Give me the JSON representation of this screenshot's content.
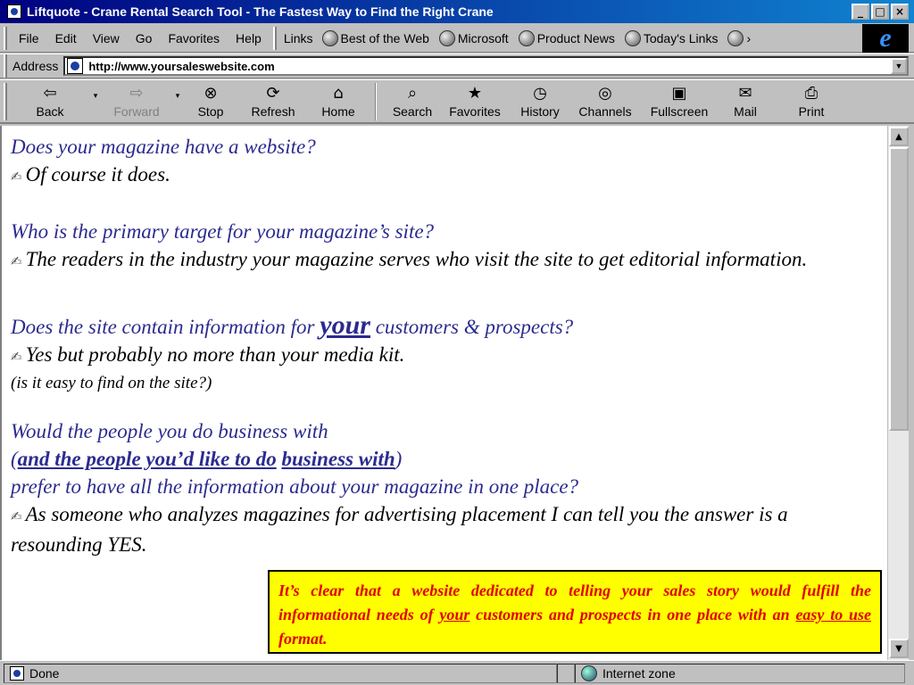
{
  "window": {
    "title": "Liftquote - Crane Rental Search Tool - The Fastest Way to Find the Right Crane",
    "controls": {
      "minimize": "_",
      "maximize": "□",
      "close": "×"
    }
  },
  "menubar": {
    "items": [
      "File",
      "Edit",
      "View",
      "Go",
      "Favorites",
      "Help"
    ],
    "links_label": "Links",
    "links": [
      "Best of the Web",
      "Microsoft",
      "Product News",
      "Today's Links"
    ],
    "more": "›",
    "logo": "e"
  },
  "address": {
    "label": "Address",
    "url": "http://www.yoursaleswebsite.com"
  },
  "toolbar": {
    "back": "Back",
    "forward": "Forward",
    "stop": "Stop",
    "refresh": "Refresh",
    "home": "Home",
    "search": "Search",
    "favorites": "Favorites",
    "history": "History",
    "channels": "Channels",
    "fullscreen": "Fullscreen",
    "mail": "Mail",
    "print": "Print"
  },
  "content": {
    "q1": "Does your magazine have a website?",
    "a1": "Of course it does.",
    "q2": "Who is the primary target for your magazine’s site?",
    "a2": "The readers in the industry your magazine serves who visit the site to get editorial information.",
    "q3_pre": "Does the site contain information for ",
    "q3_emph": "your",
    "q3_post": " customers & prospects?",
    "a3": "Yes but probably no more than your media kit.",
    "a3_note": "(is it easy to find on the site?)",
    "q4_line1": "Would the people you do business with",
    "q4_open": "(",
    "q4_link1": "and the people you’d like to do",
    "q4_space": " ",
    "q4_link2": "business with",
    "q4_close": ")",
    "q4_line3": "prefer to have all the information about your magazine in one place?",
    "a4": "As someone who analyzes magazines for advertising placement I can tell you the answer is a resounding YES.",
    "callout_pre": "It’s clear that a website dedicated to telling your sales story would fulfill the informational needs of ",
    "callout_u1": "your",
    "callout_mid": " customers and prospects in one place with an ",
    "callout_u2": "easy to use",
    "callout_post": " format."
  },
  "status": {
    "text": "Done",
    "zone": "Internet zone"
  },
  "icons": {
    "bullet": "✍",
    "back": "⇦",
    "forward": "⇨",
    "stop": "⊗",
    "refresh": "⟳",
    "home": "⌂",
    "search": "⌕",
    "favorites": "★",
    "history": "◷",
    "channels": "◎",
    "fullscreen": "▣",
    "mail": "✉",
    "print": "⎙",
    "dropdown": "▾",
    "scroll_up": "▲",
    "scroll_down": "▼"
  },
  "colors": {
    "title_bar": "#000080",
    "question_text": "#2b2b8f",
    "callout_bg": "#ffff00",
    "callout_text": "#e00000"
  }
}
